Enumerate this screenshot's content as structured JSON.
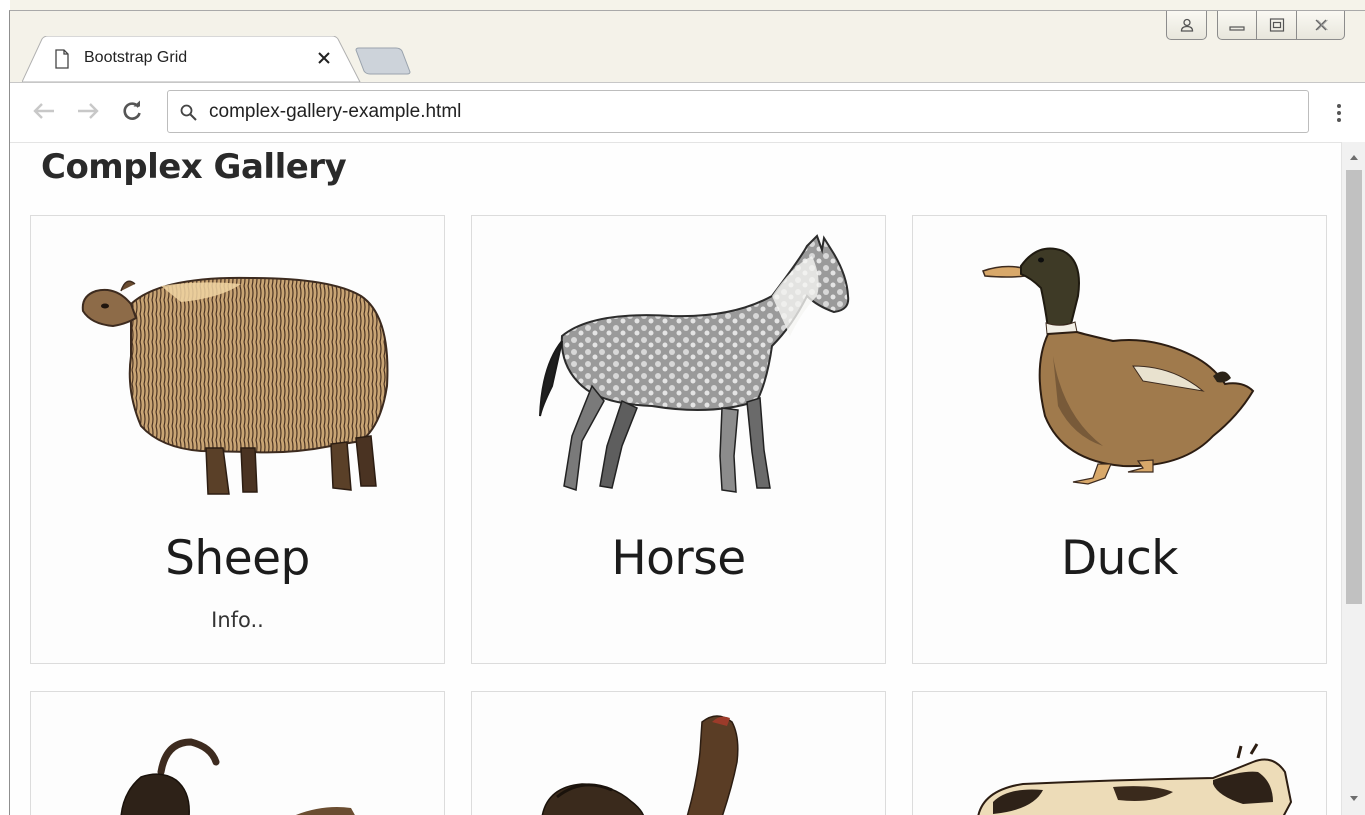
{
  "browser": {
    "tab": {
      "title": "Bootstrap Grid"
    },
    "address_bar": {
      "value": "complex-gallery-example.html"
    }
  },
  "page": {
    "title": "Complex Gallery",
    "cards": [
      {
        "name": "Sheep",
        "info": "Info.."
      },
      {
        "name": "Horse",
        "info": ""
      },
      {
        "name": "Duck",
        "info": ""
      }
    ]
  },
  "icons": {
    "tab_favicon": "page-icon",
    "tab_close": "close-icon",
    "back": "arrow-left-icon",
    "forward": "arrow-right-icon",
    "reload": "reload-icon",
    "search": "search-icon",
    "menu": "kebab-menu-icon",
    "user": "user-icon",
    "minimize": "minimize-icon",
    "maximize": "maximize-icon",
    "close_window": "close-icon"
  },
  "colors": {
    "engraving_dark": "#3d2b1f",
    "engraving_mid": "#8b6a45",
    "engraving_light": "#e9cf9f",
    "scroll_thumb": "#c1c1c1"
  }
}
